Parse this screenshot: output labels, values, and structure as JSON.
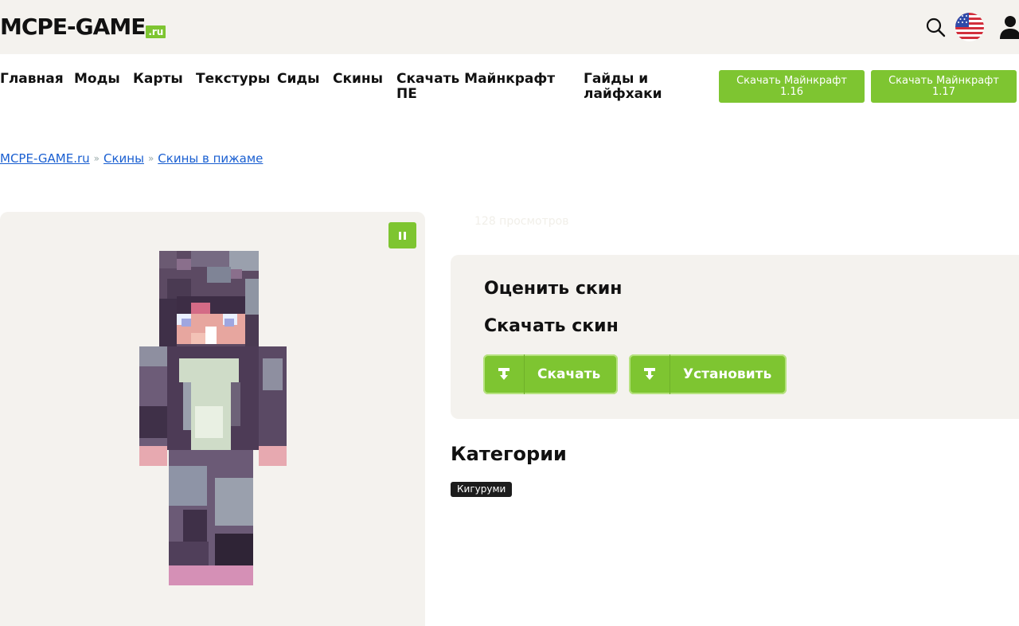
{
  "header": {
    "logo_main": "MCPE-GAME",
    "logo_suffix": ".ru"
  },
  "nav": {
    "items": [
      {
        "label": "Главная"
      },
      {
        "label": "Моды"
      },
      {
        "label": "Карты"
      },
      {
        "label": "Текстуры"
      },
      {
        "label": "Сиды"
      },
      {
        "label": "Скины"
      },
      {
        "label_line1": "Скачать Майнкрафт",
        "label_line2": "ПЕ"
      },
      {
        "label_line1": "Гайды и",
        "label_line2": "лайфхаки"
      }
    ],
    "buttons": [
      {
        "line1": "Скачать Майнкрафт",
        "line2": "1.16"
      },
      {
        "line1": "Скачать Майнкрафт",
        "line2": "1.17"
      }
    ]
  },
  "breadcrumb": {
    "items": [
      "MCPE-GAME.ru",
      "Скины",
      "Скины в пижаме"
    ],
    "separator": "»"
  },
  "skin": {
    "views": "128 просмотров"
  },
  "actions": {
    "rate_title": "Оценить скин",
    "download_title": "Скачать скин",
    "download_label": "Скачать",
    "install_label": "Установить"
  },
  "categories": {
    "title": "Категории",
    "tags": [
      "Кигуруми"
    ]
  },
  "colors": {
    "accent": "#7ec531",
    "link": "#1a5fd1",
    "panel": "#f4f2ee"
  }
}
